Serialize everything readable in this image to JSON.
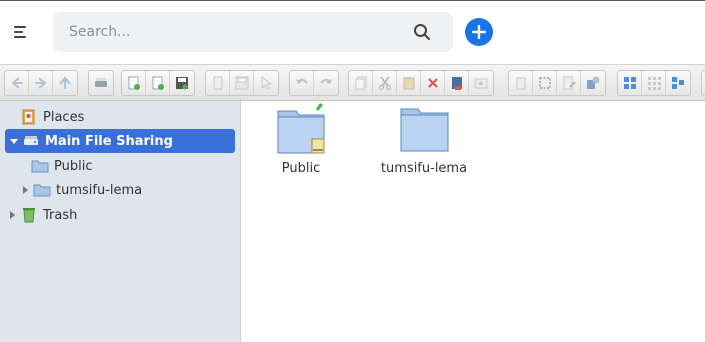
{
  "header": {
    "search_placeholder": "Search...",
    "menu_icon": "hamburger-menu-icon",
    "search_icon": "search-icon",
    "add_icon": "plus-icon",
    "accent": "#1a73e8"
  },
  "toolbar": {
    "groups": [
      [
        "back-icon",
        "forward-icon",
        "up-icon"
      ],
      [
        "drive-icon"
      ],
      [
        "new-folder-icon",
        "new-file-icon",
        "save-icon"
      ],
      [
        "copy-icon",
        "disk-icon",
        "pointer-icon"
      ],
      [
        "undo-icon",
        "redo-icon"
      ],
      [
        "copy-doc-icon",
        "cut-icon",
        "paste-icon",
        "delete-icon",
        "archive-icon",
        "extract-icon"
      ],
      [
        "page-icon",
        "select-icon",
        "edit-icon",
        "settings-icon"
      ],
      [
        "grid-view-icon",
        "small-grid-icon",
        "detail-view-icon"
      ]
    ]
  },
  "sidebar": {
    "places": "Places",
    "main_share": "Main File Sharing",
    "public": "Public",
    "user_folder": "tumsifu-lema",
    "trash": "Trash",
    "selected_color": "#3a6fd8"
  },
  "main": {
    "items": [
      {
        "label": "Public",
        "icon": "shared-folder-icon"
      },
      {
        "label": "tumsifu-lema",
        "icon": "folder-icon"
      }
    ]
  }
}
